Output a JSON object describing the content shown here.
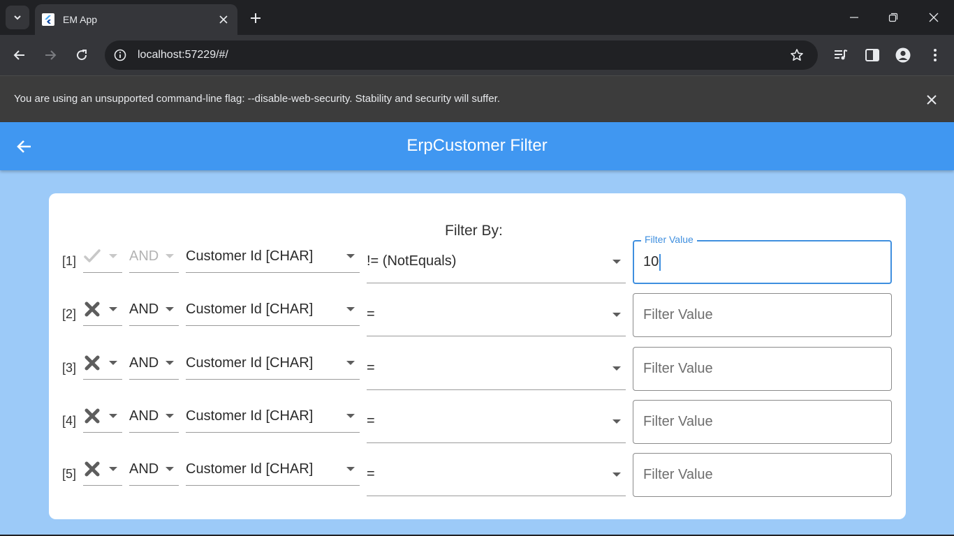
{
  "browser": {
    "tab_title": "EM App",
    "url": "localhost:57229/#/",
    "infobar_text": "You are using an unsupported command-line flag: --disable-web-security. Stability and security will suffer."
  },
  "app": {
    "title": "ErpCustomer Filter",
    "filter_heading": "Filter By:"
  },
  "filter_rows": [
    {
      "index": "[1]",
      "enabled_icon": "check-icon",
      "conjunction": "AND",
      "conjunction_muted": true,
      "field": "Customer Id [CHAR]",
      "operator": "!= (NotEquals)",
      "value": "10",
      "value_label": "Filter Value",
      "placeholder": "Filter Value",
      "focused": true
    },
    {
      "index": "[2]",
      "enabled_icon": "x-mark-icon",
      "conjunction": "AND",
      "conjunction_muted": false,
      "field": "Customer Id [CHAR]",
      "operator": "=",
      "value": "",
      "value_label": "Filter Value",
      "placeholder": "Filter Value",
      "focused": false
    },
    {
      "index": "[3]",
      "enabled_icon": "x-mark-icon",
      "conjunction": "AND",
      "conjunction_muted": false,
      "field": "Customer Id [CHAR]",
      "operator": "=",
      "value": "",
      "value_label": "Filter Value",
      "placeholder": "Filter Value",
      "focused": false
    },
    {
      "index": "[4]",
      "enabled_icon": "x-mark-icon",
      "conjunction": "AND",
      "conjunction_muted": false,
      "field": "Customer Id [CHAR]",
      "operator": "=",
      "value": "",
      "value_label": "Filter Value",
      "placeholder": "Filter Value",
      "focused": false
    },
    {
      "index": "[5]",
      "enabled_icon": "x-mark-icon",
      "conjunction": "AND",
      "conjunction_muted": false,
      "field": "Customer Id [CHAR]",
      "operator": "=",
      "value": "",
      "value_label": "Filter Value",
      "placeholder": "Filter Value",
      "focused": false
    }
  ],
  "colors": {
    "appbar": "#4097f1",
    "background": "#9ccaf8",
    "focus": "#3f8fdf"
  }
}
